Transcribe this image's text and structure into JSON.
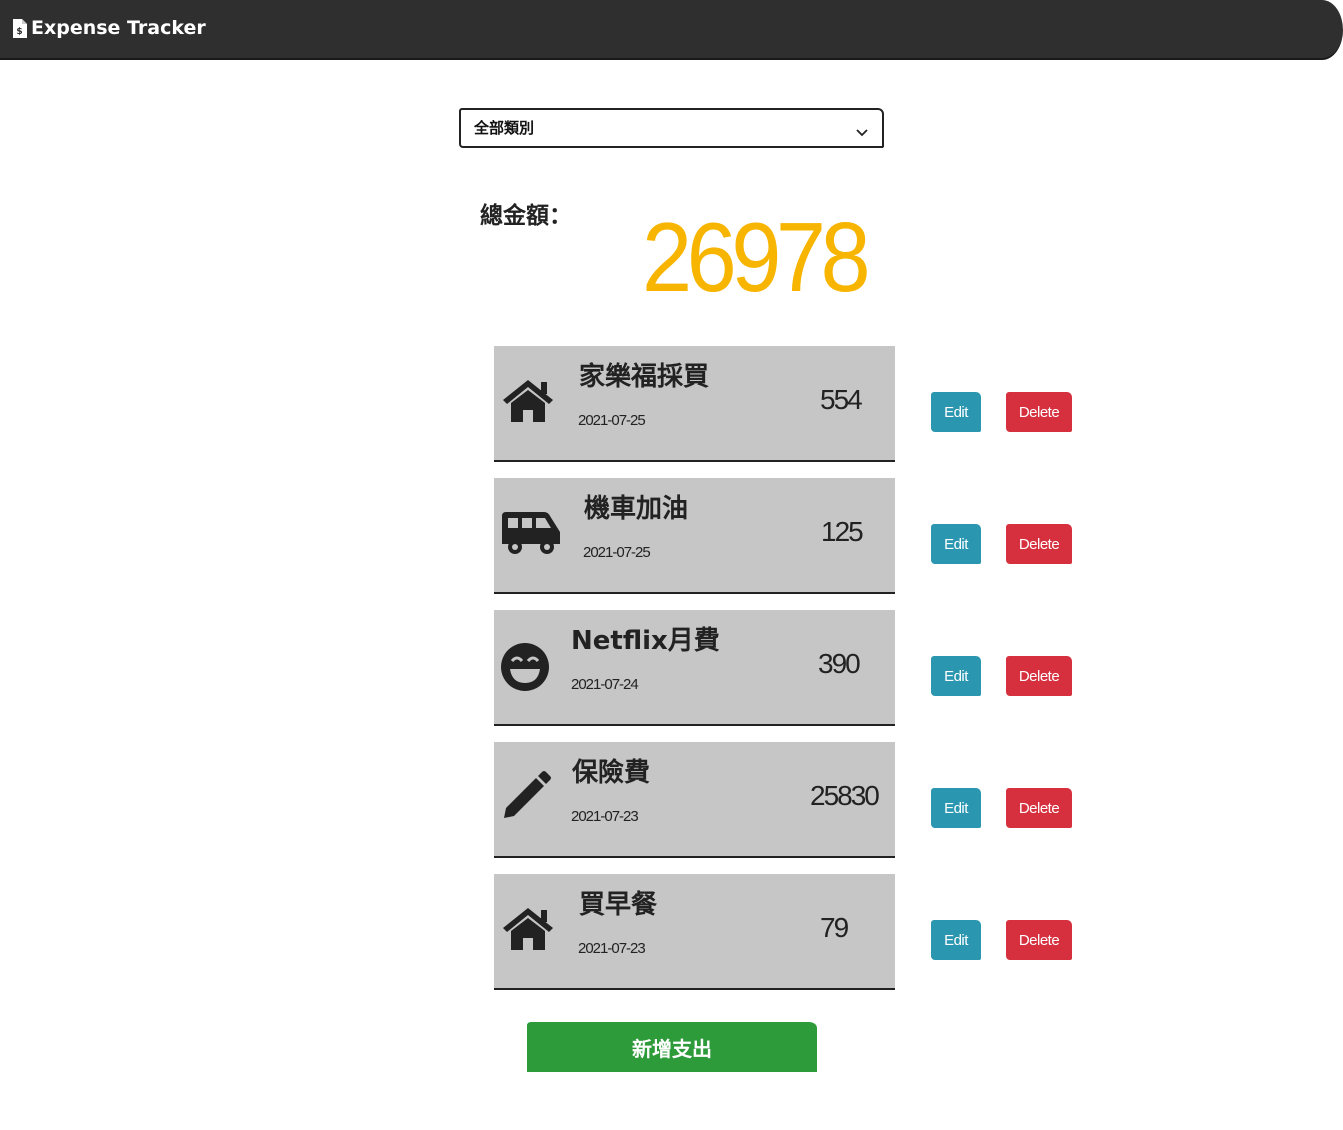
{
  "navbar": {
    "brand_icon": "file-invoice-dollar-icon",
    "brand_label": "Expense Tracker"
  },
  "filter": {
    "selected": "全部類別",
    "icon": "chevron-down-icon"
  },
  "summary": {
    "label": "總金額：",
    "total": "26978",
    "total_color": "#f7b500"
  },
  "records": [
    {
      "icon": "home-icon",
      "name": "家樂福採買",
      "date": "2021-07-25",
      "amount": "554",
      "edit_label": "Edit",
      "delete_label": "Delete"
    },
    {
      "icon": "shuttle-van-icon",
      "name": "機車加油",
      "date": "2021-07-25",
      "amount": "125",
      "edit_label": "Edit",
      "delete_label": "Delete"
    },
    {
      "icon": "grin-icon",
      "name": "Netflix月費",
      "date": "2021-07-24",
      "amount": "390",
      "edit_label": "Edit",
      "delete_label": "Delete"
    },
    {
      "icon": "pen-icon",
      "name": "保險費",
      "date": "2021-07-23",
      "amount": "25830",
      "edit_label": "Edit",
      "delete_label": "Delete"
    },
    {
      "icon": "home-icon",
      "name": "買早餐",
      "date": "2021-07-23",
      "amount": "79",
      "edit_label": "Edit",
      "delete_label": "Delete"
    }
  ],
  "actions": {
    "add_label": "新增支出"
  },
  "colors": {
    "navbar": "#2f2f2f",
    "card": "#c6c6c6",
    "edit": "#2b96b0",
    "delete": "#d6303f",
    "add": "#2e9b3b"
  }
}
